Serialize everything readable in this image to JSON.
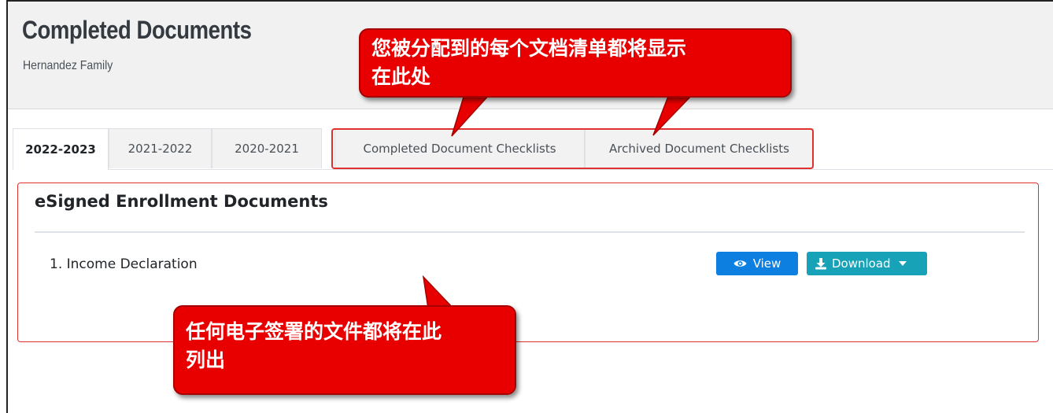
{
  "header": {
    "title": "Completed Documents",
    "subtitle": "Hernandez Family"
  },
  "tabs": [
    {
      "label": "2022-2023",
      "active": true
    },
    {
      "label": "2021-2022",
      "active": false
    },
    {
      "label": "2020-2021",
      "active": false
    },
    {
      "label": "Completed Document Checklists",
      "active": false
    },
    {
      "label": "Archived Document Checklists",
      "active": false
    }
  ],
  "section": {
    "title": "eSigned Enrollment Documents",
    "documents": [
      {
        "name": "1. Income Declaration"
      }
    ]
  },
  "buttons": {
    "view_label": "View",
    "download_label": "Download"
  },
  "icons": {
    "view": "eye-icon",
    "download": "download-icon",
    "caret": "caret-down-icon"
  },
  "annotations": {
    "top": {
      "line1": "您被分配到的每个文档清单都将显示",
      "line2": "在此处"
    },
    "bottom": {
      "line1": "任何电子签署的文件都将在此",
      "line2": "列出"
    }
  },
  "colors": {
    "view_button": "#0d7fe0",
    "download_button": "#17a2b8",
    "callout": "#e80000",
    "highlight_border": "#e03131"
  }
}
